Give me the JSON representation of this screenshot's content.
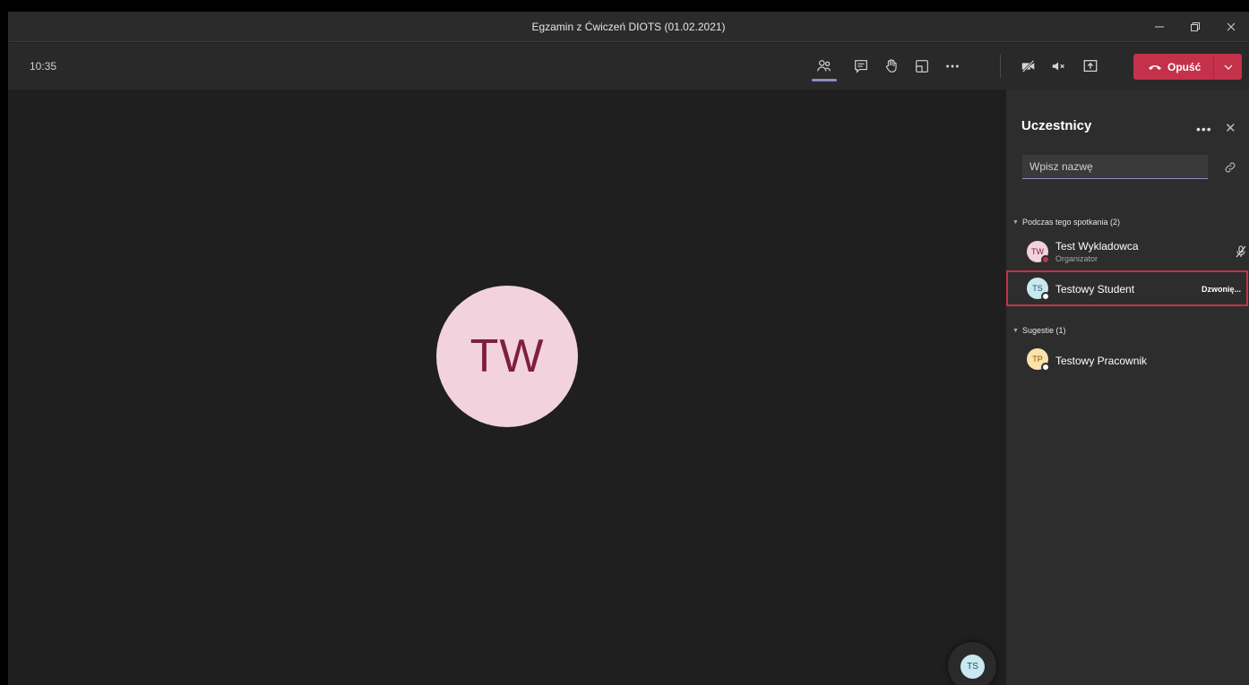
{
  "window": {
    "title": "Egzamin z Ćwiczeń DIOTS (01.02.2021)"
  },
  "toolbar": {
    "time": "10:35",
    "icons": [
      "participants-icon",
      "chat-icon",
      "raise-hand-icon",
      "rooms-icon",
      "more-icon",
      "camera-off-icon",
      "mic-muted-icon",
      "share-screen-icon"
    ],
    "leave_label": "Opuść"
  },
  "stage": {
    "main_avatar_initials": "TW",
    "self_avatar_initials": "TS"
  },
  "panel": {
    "title": "Uczestnicy",
    "search_placeholder": "Wpisz nazwę",
    "in_meeting_header": "Podczas tego spotkania (2)",
    "participants": [
      {
        "initials": "TW",
        "name": "Test Wykladowca",
        "role": "Organizator",
        "status_icon": "mic-off-icon"
      },
      {
        "initials": "TS",
        "name": "Testowy Student",
        "status": "Dzwonię..."
      }
    ],
    "suggestions_header": "Sugestie (1)",
    "suggestions": [
      {
        "initials": "TP",
        "name": "Testowy Pracownik"
      }
    ]
  },
  "colors": {
    "accent": "#8b8cc7",
    "leave": "#c4314b",
    "highlight": "#c4314b"
  }
}
